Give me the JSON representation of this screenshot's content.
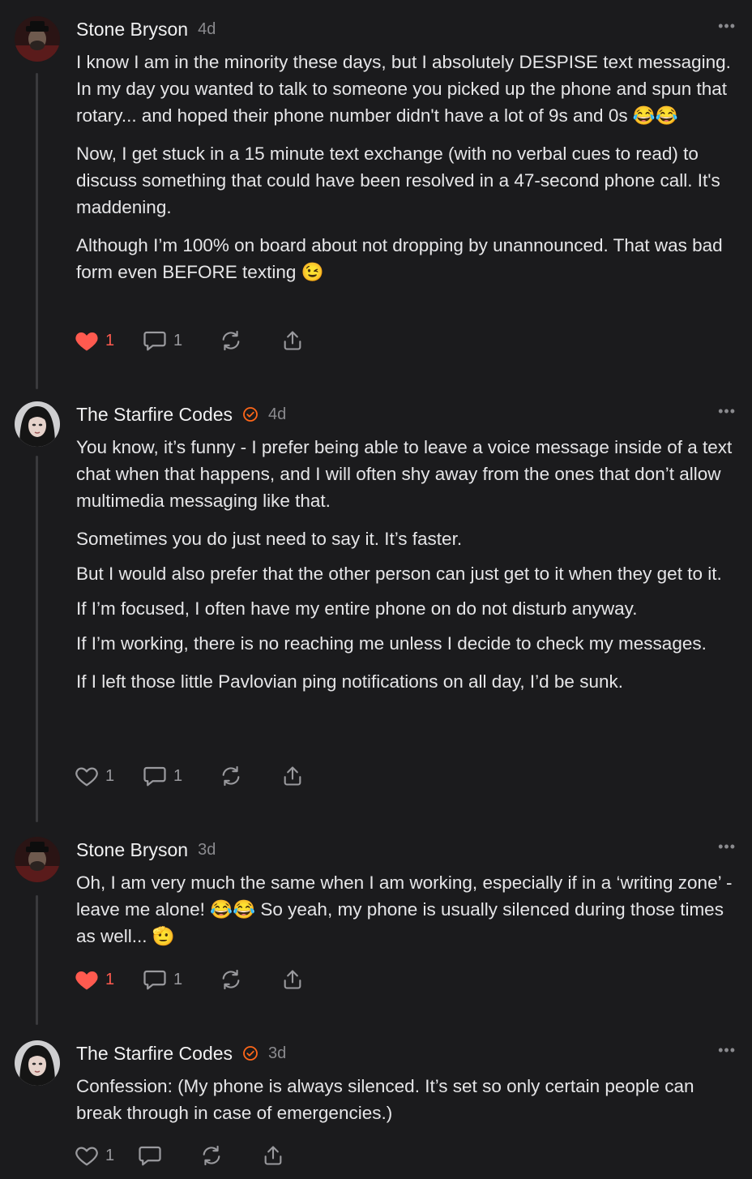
{
  "comments": [
    {
      "author": "Stone Bryson",
      "time": "4d",
      "verified": false,
      "paragraphs": [
        "I know I am in the minority these days, but I absolutely DESPISE text messaging. In my day you wanted to talk to someone you picked up the phone and spun that rotary... and hoped their phone number didn't have a lot of 9s and 0s 😂😂",
        "Now, I get stuck in a 15 minute text exchange (with no verbal cues to read) to discuss something that could have been resolved in a 47-second phone call. It's maddening.",
        "Although I’m 100% on board about not dropping by unannounced. That was bad form even BEFORE texting 😉"
      ],
      "likes": "1",
      "liked": true,
      "replies": "1"
    },
    {
      "author": "The Starfire Codes",
      "time": "4d",
      "verified": true,
      "paragraphs": [
        "You know, it’s funny - I prefer being able to leave a voice message inside of a text chat when that happens, and I will often shy away from the ones that don’t allow multimedia messaging like that.",
        "Sometimes you do just need to say it. It’s faster.",
        "But I would also prefer that the other person can just get to it when they get to it.",
        "If I’m focused, I often have my entire phone on do not disturb anyway.",
        "If I’m working, there is no reaching me unless I decide to check my messages.",
        "If I left those little Pavlovian ping notifications on all day, I’d be sunk."
      ],
      "likes": "1",
      "liked": false,
      "replies": "1"
    },
    {
      "author": "Stone Bryson",
      "time": "3d",
      "verified": false,
      "paragraphs": [
        "Oh, I am very much the same when I am working, especially if in a ‘writing zone’ - leave me alone! 😂😂 So yeah, my phone is usually silenced during those times as well... 🫡"
      ],
      "likes": "1",
      "liked": true,
      "replies": "1"
    },
    {
      "author": "The Starfire Codes",
      "time": "3d",
      "verified": true,
      "paragraphs": [
        "Confession: (My phone is always silenced. It’s set so only certain people can break through in case of emergencies.)"
      ],
      "likes": "1",
      "liked": false,
      "replies": ""
    }
  ],
  "more_menu_glyph": "•••",
  "colors": {
    "background": "#1b1b1d",
    "like_active": "#ff5a4f",
    "verified": "#ff6719",
    "muted": "#8a8a8e"
  }
}
